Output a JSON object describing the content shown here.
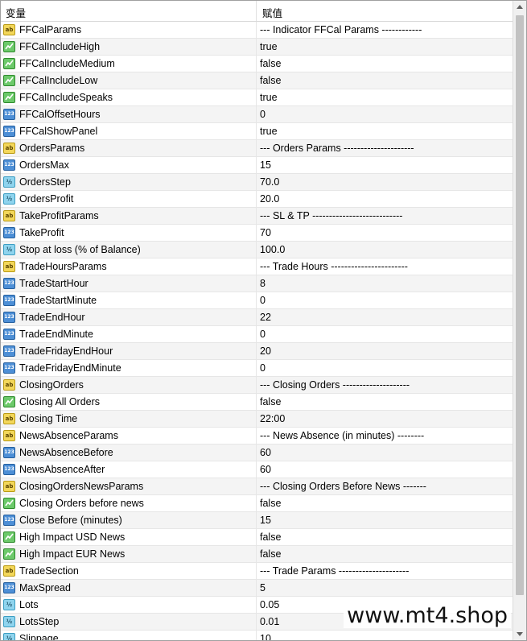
{
  "header": {
    "name_label": "变量",
    "value_label": "赋值"
  },
  "rows": [
    {
      "type": "string",
      "name": "FFCalParams",
      "value": "--- Indicator FFCal Params ------------"
    },
    {
      "type": "bool",
      "name": "FFCalIncludeHigh",
      "value": "true"
    },
    {
      "type": "bool",
      "name": "FFCalIncludeMedium",
      "value": "false"
    },
    {
      "type": "bool",
      "name": "FFCalIncludeLow",
      "value": "false"
    },
    {
      "type": "bool",
      "name": "FFCalIncludeSpeaks",
      "value": "true"
    },
    {
      "type": "int",
      "name": "FFCalOffsetHours",
      "value": "0"
    },
    {
      "type": "int",
      "name": "FFCalShowPanel",
      "value": "true"
    },
    {
      "type": "string",
      "name": "OrdersParams",
      "value": "--- Orders Params ---------------------"
    },
    {
      "type": "int",
      "name": "OrdersMax",
      "value": "15"
    },
    {
      "type": "double",
      "name": "OrdersStep",
      "value": "70.0"
    },
    {
      "type": "double",
      "name": "OrdersProfit",
      "value": "20.0"
    },
    {
      "type": "string",
      "name": "TakeProfitParams",
      "value": "--- SL & TP ---------------------------"
    },
    {
      "type": "int",
      "name": "TakeProfit",
      "value": "70"
    },
    {
      "type": "double",
      "name": "Stop at loss (% of Balance)",
      "value": "100.0"
    },
    {
      "type": "string",
      "name": "TradeHoursParams",
      "value": "--- Trade Hours -----------------------"
    },
    {
      "type": "int",
      "name": "TradeStartHour",
      "value": "8"
    },
    {
      "type": "int",
      "name": "TradeStartMinute",
      "value": "0"
    },
    {
      "type": "int",
      "name": "TradeEndHour",
      "value": "22"
    },
    {
      "type": "int",
      "name": "TradeEndMinute",
      "value": "0"
    },
    {
      "type": "int",
      "name": "TradeFridayEndHour",
      "value": "20"
    },
    {
      "type": "int",
      "name": "TradeFridayEndMinute",
      "value": "0"
    },
    {
      "type": "string",
      "name": "ClosingOrders",
      "value": "--- Closing Orders --------------------"
    },
    {
      "type": "bool",
      "name": "Closing All Orders",
      "value": "false"
    },
    {
      "type": "string",
      "name": "Closing Time",
      "value": "22:00"
    },
    {
      "type": "string",
      "name": "NewsAbsenceParams",
      "value": "--- News Absence (in minutes) --------"
    },
    {
      "type": "int",
      "name": "NewsAbsenceBefore",
      "value": "60"
    },
    {
      "type": "int",
      "name": "NewsAbsenceAfter",
      "value": "60"
    },
    {
      "type": "string",
      "name": "ClosingOrdersNewsParams",
      "value": "--- Closing Orders Before News -------"
    },
    {
      "type": "bool",
      "name": "Closing Orders before news",
      "value": "false"
    },
    {
      "type": "int",
      "name": "Close Before (minutes)",
      "value": "15"
    },
    {
      "type": "bool",
      "name": "High Impact USD News",
      "value": "false"
    },
    {
      "type": "bool",
      "name": "High Impact EUR News",
      "value": "false"
    },
    {
      "type": "string",
      "name": "TradeSection",
      "value": "--- Trade Params ---------------------"
    },
    {
      "type": "int",
      "name": "MaxSpread",
      "value": "5"
    },
    {
      "type": "double",
      "name": "Lots",
      "value": "0.05"
    },
    {
      "type": "double",
      "name": "LotsStep",
      "value": "0.01"
    },
    {
      "type": "double",
      "name": "Slippage",
      "value": "10"
    }
  ],
  "icons": {
    "string": {
      "semantic": "string-type-icon",
      "glyph": "ab",
      "color": "#f3d75a"
    },
    "bool": {
      "semantic": "bool-type-icon",
      "glyph": "",
      "color": "#6cc96a"
    },
    "int": {
      "semantic": "integer-type-icon",
      "glyph": "123",
      "color": "#4d8fd6"
    },
    "double": {
      "semantic": "double-type-icon",
      "glyph": "½",
      "color": "#8fd4ee"
    }
  },
  "watermark": "www.mt4.shop"
}
